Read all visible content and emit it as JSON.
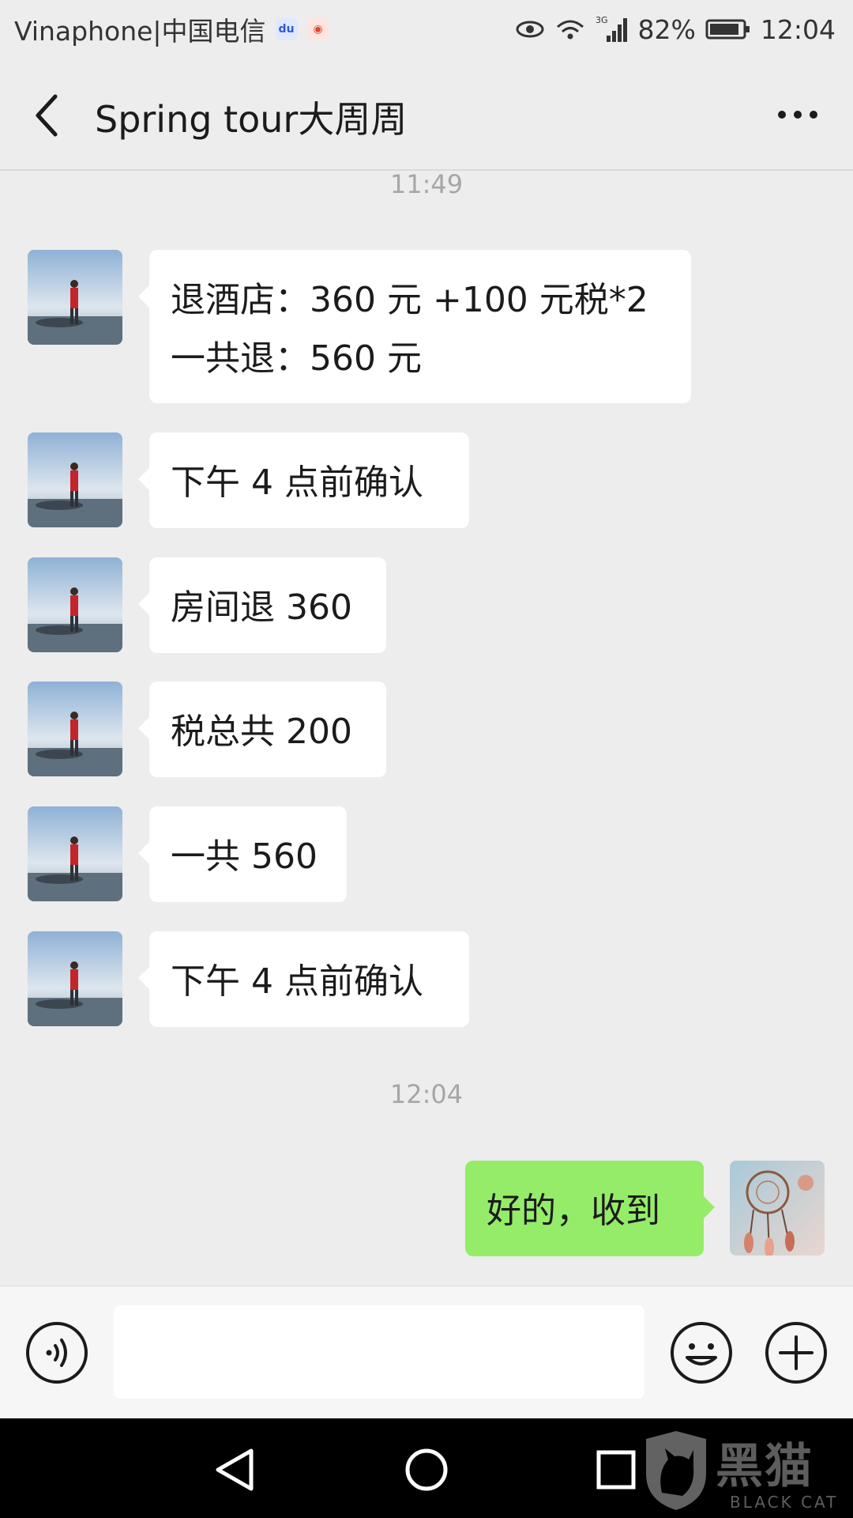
{
  "status_bar": {
    "carrier": "Vinaphone|中国电信",
    "network": "3G",
    "battery": "82%",
    "time": "12:04",
    "app_badges": [
      "baidu-icon",
      "weibo-icon"
    ]
  },
  "header": {
    "title": "Spring tour大周周"
  },
  "messages": [
    {
      "type": "time",
      "text": "11:49"
    },
    {
      "type": "incoming",
      "lines": [
        "退酒店：360 元 +100 元税*2",
        "一共退：560 元"
      ]
    },
    {
      "type": "incoming",
      "lines": [
        "下午 4 点前确认"
      ]
    },
    {
      "type": "incoming",
      "lines": [
        "房间退 360"
      ]
    },
    {
      "type": "incoming",
      "lines": [
        "税总共 200"
      ]
    },
    {
      "type": "incoming",
      "lines": [
        "一共 560"
      ]
    },
    {
      "type": "incoming",
      "lines": [
        "下午 4 点前确认"
      ]
    },
    {
      "type": "time",
      "text": "12:04"
    },
    {
      "type": "outgoing",
      "lines": [
        "好的，收到"
      ]
    }
  ],
  "input_bar": {
    "value": "",
    "icons": [
      "voice-icon",
      "emoji-icon",
      "plus-icon"
    ]
  },
  "nav_bar": {
    "icons": [
      "back-triangle-icon",
      "home-circle-icon",
      "recent-square-icon"
    ]
  },
  "watermark": {
    "text": "黑猫",
    "sub": "BLACK CAT"
  },
  "colors": {
    "background": "#ededed",
    "incoming_bubble": "#ffffff",
    "outgoing_bubble": "#95ec69",
    "time_text": "#a6a6a6"
  }
}
